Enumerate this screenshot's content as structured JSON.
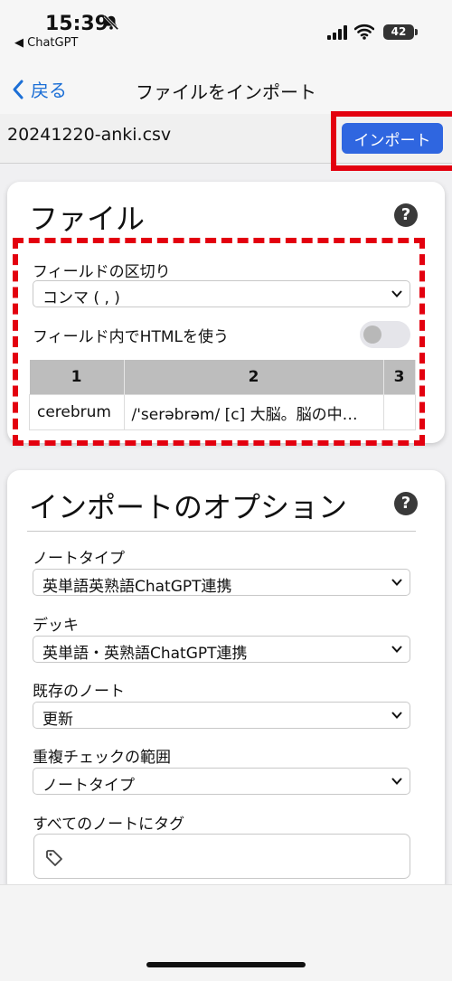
{
  "status": {
    "time": "15:39",
    "back_app": "◀ ChatGPT",
    "battery": "42"
  },
  "nav": {
    "back_label": "戻る",
    "title": "ファイルをインポート"
  },
  "file": {
    "name": "20241220-anki.csv",
    "import_label": "インポート"
  },
  "file_card": {
    "title": "ファイル",
    "help": "?",
    "separator_label": "フィールドの区切り",
    "separator_value": "コンマ ( , )",
    "html_label": "フィールド内でHTMLを使う",
    "html_enabled": false,
    "preview": {
      "headers": [
        "1",
        "2",
        "3"
      ],
      "rows": [
        [
          "cerebrum",
          "/'serəbrəm/ [c] 大脳。脳の中…",
          ""
        ]
      ]
    }
  },
  "options_card": {
    "title": "インポートのオプション",
    "help": "?",
    "notetype_label": "ノートタイプ",
    "notetype_value": "英単語英熟語ChatGPT連携",
    "deck_label": "デッキ",
    "deck_value": "英単語・英熟語ChatGPT連携",
    "existing_label": "既存のノート",
    "existing_value": "更新",
    "dupe_label": "重複チェックの範囲",
    "dupe_value": "ノートタイプ",
    "tags_label": "すべてのノートにタグ"
  },
  "icons": {
    "bell": "bell-slash-icon",
    "signal": "signal-icon",
    "wifi": "wifi-icon",
    "back": "chevron-left-icon",
    "chevron": "chevron-down-icon",
    "tag": "tag-icon"
  },
  "colors": {
    "accent": "#2f66e0",
    "link": "#1c6fd6",
    "highlight": "#e3000f"
  }
}
